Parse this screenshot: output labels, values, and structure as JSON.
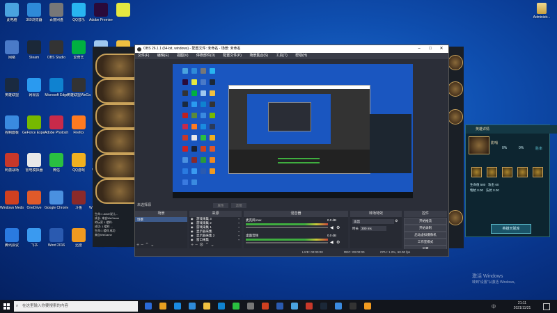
{
  "desktop": {
    "icons": [
      {
        "label": "此电脑",
        "color": "#4aa3df"
      },
      {
        "label": "360浏览器",
        "color": "#2e8ad8"
      },
      {
        "label": "百度网盘",
        "color": "#777"
      },
      {
        "label": "QQ音乐",
        "color": "#28b5f0"
      },
      {
        "label": "Adobe Premiere",
        "color": "#2a0a3a"
      },
      {
        "label": "",
        "color": "#e5e840"
      },
      {
        "label": "网络",
        "color": "#4a7ac8"
      },
      {
        "label": "Steam",
        "color": "#1b2838"
      },
      {
        "label": "OBS Studio",
        "color": "#333"
      },
      {
        "label": "爱奇艺",
        "color": "#00b140"
      },
      {
        "label": "回收站",
        "color": "#9fc8ef"
      },
      {
        "label": "WeGame",
        "color": "#f0c040"
      },
      {
        "label": "英雄联盟",
        "color": "#1a2a40"
      },
      {
        "label": "网易云",
        "color": "#2a9af0"
      },
      {
        "label": "Microsoft Edge",
        "color": "#0f82d0"
      },
      {
        "label": "英雄联盟WeGame版",
        "color": "#333"
      },
      {
        "label": "QQ飞车",
        "color": "#c02020"
      },
      {
        "label": "Minecraft",
        "color": "#5a8a3a"
      },
      {
        "label": "控制面板",
        "color": "#3a8ae0"
      },
      {
        "label": "GeForce Experience",
        "color": "#76b900"
      },
      {
        "label": "Adobe Photoshop",
        "color": "#c82a4a"
      },
      {
        "label": "Firefox",
        "color": "#ff7a20"
      },
      {
        "label": "腾讯QQ",
        "color": "#1a8ae0"
      },
      {
        "label": "WeGame版",
        "color": "#2a3a5a"
      },
      {
        "label": "刺激战场",
        "color": "#c8382a"
      },
      {
        "label": "雷电模拟器",
        "color": "#e8e8e8"
      },
      {
        "label": "微信",
        "color": "#2ac040"
      },
      {
        "label": "QQ游戏",
        "color": "#f0b020"
      },
      {
        "label": "WPS Office",
        "color": "#d02020"
      },
      {
        "label": "英雄联盟",
        "color": "#1a2030"
      },
      {
        "label": "Windows Media",
        "color": "#d04020"
      },
      {
        "label": "OneDrive",
        "color": "#e05a2a"
      },
      {
        "label": "Google Chrome",
        "color": "#4a90e0"
      },
      {
        "label": "斗鱼",
        "color": "#8a2a2a"
      },
      {
        "label": "Windows Media",
        "color": "#2a9a3a"
      },
      {
        "label": "Excel",
        "color": "#f08a20"
      },
      {
        "label": "腾讯会议",
        "color": "#2a7ae0"
      },
      {
        "label": "飞书",
        "color": "#3a9af0"
      },
      {
        "label": "Word 2016",
        "color": "#2a5ab0"
      },
      {
        "label": "迅雷",
        "color": "#f09a20"
      },
      {
        "label": "暴雪",
        "color": "#3a7ae0"
      },
      {
        "label": "QQ音乐",
        "color": "#3a8ae0"
      }
    ],
    "corner_icon_label": "Administr...",
    "watermark_title": "激活 Windows",
    "watermark_sub": "转到\"设置\"以激活 Windows。"
  },
  "obs": {
    "title": "OBS 26.1.1 (64-bit, windows) - 配置文件: 未命名 - 场景: 未命名",
    "menu": [
      "文件(F)",
      "编辑(E)",
      "视图(V)",
      "停靠部件(D)",
      "配置文件(P)",
      "场景集合(S)",
      "工具(T)",
      "帮助(H)"
    ],
    "no_source": "未选择源",
    "props_btn": "属性",
    "filters_btn": "滤镜",
    "panels": {
      "scenes": "场景",
      "sources": "来源",
      "mixer": "混音器",
      "transitions": "转场特效",
      "controls": "控件"
    },
    "scene_items": [
      "场景"
    ],
    "source_items": [
      "游戏采集 3",
      "游戏采集 2",
      "游戏采集 1",
      "显示器采集",
      "显示器采集 2",
      "窗口采集"
    ],
    "mixer": {
      "track1": "桌面音频",
      "db1": "0.0 dB",
      "track2": "麦克风/Aux",
      "db2": "0.0 dB"
    },
    "transition": {
      "type": "淡出",
      "duration_label": "时长",
      "duration": "300 ms"
    },
    "controls": [
      "开始推流",
      "开始录制",
      "启动虚拟摄像机",
      "工作室模式",
      "设置",
      "退出"
    ],
    "status": {
      "live": "LIVE: 00:00:00",
      "rec": "REC: 00:00:00",
      "cpu": "CPU: 1.2%, 60.00 fps"
    }
  },
  "game": {
    "chat": [
      "生命:1 AnkE说儿...",
      "成长: 来自WeGame",
      "的玩家 1 楼样:",
      "成功: 1 楼样 ...",
      "生命:1 楼样 成功",
      "来自WeGame"
    ]
  },
  "hero_panel": {
    "title": "英雄详情",
    "name": "影哨",
    "stat_value": "0%",
    "stat_value2": "0%",
    "stat_label": "胜率",
    "stats": [
      {
        "label": "生命值",
        "value": "580"
      },
      {
        "label": "攻击",
        "value": "60"
      },
      {
        "label": "物抗",
        "value": "0.00"
      },
      {
        "label": "法抗",
        "value": "0.00"
      }
    ],
    "store_btn": "英雄天赋库"
  },
  "taskbar": {
    "search_placeholder": "在这里输入你要搜索的内容",
    "lang": "中",
    "time": "21:11",
    "date": "2021/11/21"
  },
  "colors": {
    "accent": "#0f4fb0",
    "taskbar": "#12151c",
    "obs_bg": "#2b2e38"
  }
}
